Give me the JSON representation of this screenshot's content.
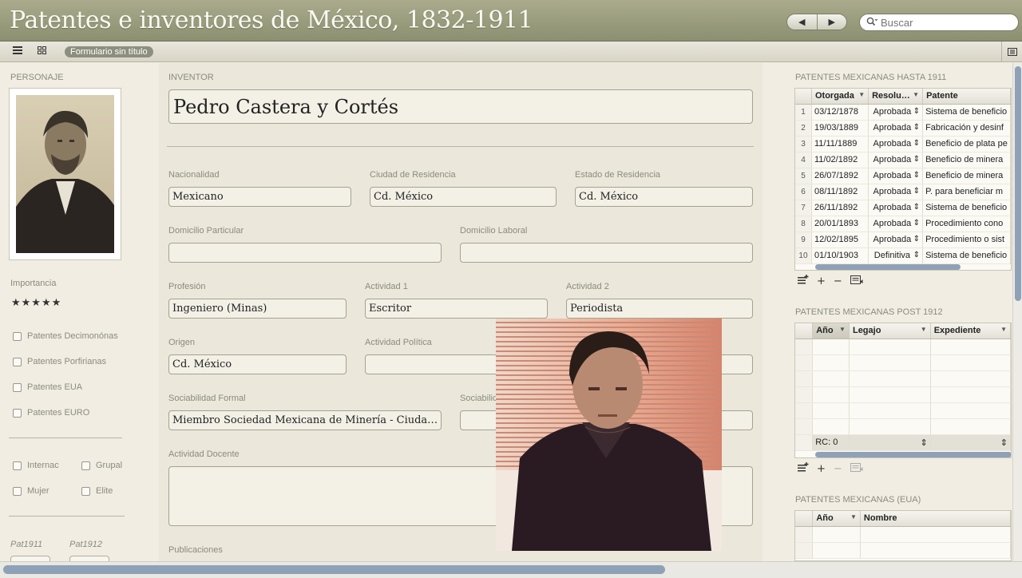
{
  "app": {
    "title": "Patentes e inventores de México, 1832-1911"
  },
  "nav": {
    "back": "◀",
    "forward": "▶"
  },
  "search": {
    "placeholder": "Buscar"
  },
  "toolbar": {
    "layout_name": "Formulario sin título"
  },
  "sidebar": {
    "personaje_label": "PERSONAJE",
    "importancia_label": "Importancia",
    "stars": "★★★★★",
    "checkboxes": [
      "Patentes Decimonónas",
      "Patentes Porfirianas",
      "Patentes EUA",
      "Patentes EURO"
    ],
    "flags": [
      "Internac",
      "Grupal",
      "Mujer",
      "Elite"
    ],
    "pat1911": "Pat1911",
    "pat1912": "Pat1912"
  },
  "form": {
    "inventor_label": "INVENTOR",
    "inventor": "Pedro Castera y Cortés",
    "nacionalidad_label": "Nacionalidad",
    "nacionalidad": "Mexicano",
    "ciudad_label": "Ciudad de Residencia",
    "ciudad": "Cd. México",
    "estado_label": "Estado de Residencia",
    "estado": "Cd. México",
    "domicilio_particular_label": "Domicilio Particular",
    "domicilio_particular": "",
    "domicilio_laboral_label": "Domicilio Laboral",
    "domicilio_laboral": "",
    "profesion_label": "Profesión",
    "profesion": "Ingeniero (Minas)",
    "actividad1_label": "Actividad 1",
    "actividad1": "Escritor",
    "actividad2_label": "Actividad 2",
    "actividad2": "Periodista",
    "origen_label": "Origen",
    "origen": "Cd. México",
    "actividad_politica_label": "Actividad Política",
    "actividad_politica": "",
    "sociabilidad_formal_label": "Sociabilidad Formal",
    "sociabilidad_formal": "Miembro Sociedad Mexicana de Minería - Ciuda…",
    "sociabilidad_informal_label": "Sociabilid",
    "actividad_docente_label": "Actividad Docente",
    "publicaciones_label": "Publicaciones"
  },
  "portal1": {
    "title": "PATENTES MEXICANAS HASTA 1911",
    "columns": [
      "Otorgada",
      "Resolu…",
      "Patente"
    ],
    "rows": [
      {
        "n": "1",
        "otorgada": "03/12/1878",
        "resol": "Aprobada",
        "patente": "Sistema de beneficio"
      },
      {
        "n": "2",
        "otorgada": "19/03/1889",
        "resol": "Aprobada",
        "patente": "Fabricación y desinf"
      },
      {
        "n": "3",
        "otorgada": "11/11/1889",
        "resol": "Aprobada",
        "patente": "Beneficio de plata pe"
      },
      {
        "n": "4",
        "otorgada": "11/02/1892",
        "resol": "Aprobada",
        "patente": "Beneficio de minera"
      },
      {
        "n": "5",
        "otorgada": "26/07/1892",
        "resol": "Aprobada",
        "patente": "Beneficio de minera"
      },
      {
        "n": "6",
        "otorgada": "08/11/1892",
        "resol": "Aprobada",
        "patente": "P. para beneficiar m"
      },
      {
        "n": "7",
        "otorgada": "26/11/1892",
        "resol": "Aprobada",
        "patente": "Sistema de beneficio"
      },
      {
        "n": "8",
        "otorgada": "20/01/1893",
        "resol": "Aprobada",
        "patente": "Procedimiento cono"
      },
      {
        "n": "9",
        "otorgada": "12/02/1895",
        "resol": "Aprobada",
        "patente": "Procedimiento o sist"
      },
      {
        "n": "10",
        "otorgada": "01/10/1903",
        "resol": "Definitiva",
        "patente": "Sistema de beneficio"
      }
    ]
  },
  "portal2": {
    "title": "PATENTES MEXICANAS POST 1912",
    "columns": [
      "Año",
      "Legajo",
      "Expediente"
    ],
    "summary": "RC: 0"
  },
  "portal3": {
    "title": "PATENTES MEXICANAS (EUA)",
    "columns": [
      "Año",
      "Nombre"
    ]
  },
  "portal_controls": {
    "add": "+",
    "remove": "−"
  }
}
